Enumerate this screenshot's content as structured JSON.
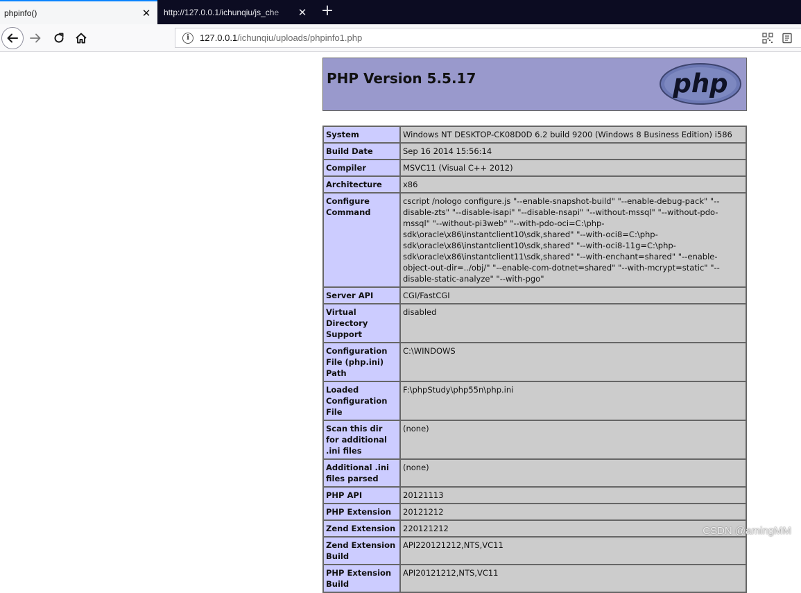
{
  "browser": {
    "tabs": [
      {
        "title": "phpinfo()",
        "active": true
      },
      {
        "title": "http://127.0.0.1/ichunqiu/js_che",
        "active": false
      }
    ],
    "close_symbol": "✕",
    "new_tab_symbol": "+",
    "url": {
      "host": "127.0.0.1",
      "path": "/ichunqiu/uploads/phpinfo1.php"
    },
    "icons": [
      "back-arrow-icon",
      "forward-arrow-icon",
      "reload-icon",
      "home-icon",
      "info-icon",
      "qr-code-icon",
      "reader-view-icon"
    ]
  },
  "php": {
    "title": "PHP Version 5.5.17",
    "logo_text": "php",
    "colors": {
      "header": "#9999cc",
      "label_cell": "#ccccff",
      "value_cell": "#cccccc"
    },
    "rows": [
      {
        "label": "System",
        "value": "Windows NT DESKTOP-CK08D0D 6.2 build 9200 (Windows 8 Business Edition) i586"
      },
      {
        "label": "Build Date",
        "value": "Sep 16 2014 15:56:14"
      },
      {
        "label": "Compiler",
        "value": "MSVC11 (Visual C++ 2012)"
      },
      {
        "label": "Architecture",
        "value": "x86"
      },
      {
        "label": "Configure Command",
        "value": "cscript /nologo configure.js \"--enable-snapshot-build\" \"--enable-debug-pack\" \"--disable-zts\" \"--disable-isapi\" \"--disable-nsapi\" \"--without-mssql\" \"--without-pdo-mssql\" \"--without-pi3web\" \"--with-pdo-oci=C:\\php-sdk\\oracle\\x86\\instantclient10\\sdk,shared\" \"--with-oci8=C:\\php-sdk\\oracle\\x86\\instantclient10\\sdk,shared\" \"--with-oci8-11g=C:\\php-sdk\\oracle\\x86\\instantclient11\\sdk,shared\" \"--with-enchant=shared\" \"--enable-object-out-dir=../obj/\" \"--enable-com-dotnet=shared\" \"--with-mcrypt=static\" \"--disable-static-analyze\" \"--with-pgo\""
      },
      {
        "label": "Server API",
        "value": "CGI/FastCGI"
      },
      {
        "label": "Virtual Directory Support",
        "value": "disabled"
      },
      {
        "label": "Configuration File (php.ini) Path",
        "value": "C:\\WINDOWS"
      },
      {
        "label": "Loaded Configuration File",
        "value": "F:\\phpStudy\\php55n\\php.ini"
      },
      {
        "label": "Scan this dir for additional .ini files",
        "value": "(none)"
      },
      {
        "label": "Additional .ini files parsed",
        "value": "(none)"
      },
      {
        "label": "PHP API",
        "value": "20121113"
      },
      {
        "label": "PHP Extension",
        "value": "20121212"
      },
      {
        "label": "Zend Extension",
        "value": "220121212"
      },
      {
        "label": "Zend Extension Build",
        "value": "API220121212,NTS,VC11"
      },
      {
        "label": "PHP Extension Build",
        "value": "API20121212,NTS,VC11"
      }
    ]
  },
  "watermark": "CSDN @amingMM"
}
